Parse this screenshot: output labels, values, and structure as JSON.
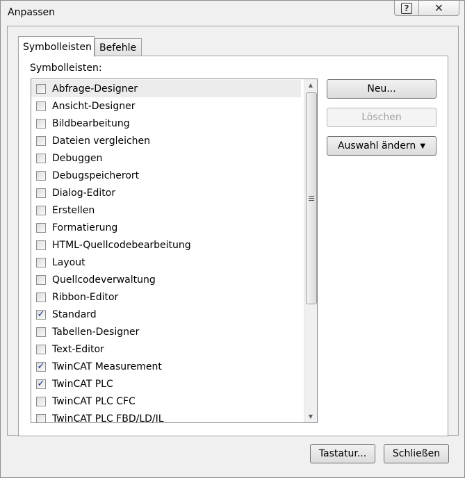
{
  "window": {
    "title": "Anpassen",
    "help_glyph": "?",
    "close_glyph": "✕"
  },
  "tabs": [
    {
      "label": "Symbolleisten",
      "active": true
    },
    {
      "label": "Befehle",
      "active": false
    }
  ],
  "toolbars_section": {
    "label": "Symbolleisten:",
    "items": [
      {
        "label": "Abfrage-Designer",
        "checked": false,
        "selected": true
      },
      {
        "label": "Ansicht-Designer",
        "checked": false
      },
      {
        "label": "Bildbearbeitung",
        "checked": false
      },
      {
        "label": "Dateien vergleichen",
        "checked": false
      },
      {
        "label": "Debuggen",
        "checked": false
      },
      {
        "label": "Debugspeicherort",
        "checked": false
      },
      {
        "label": "Dialog-Editor",
        "checked": false
      },
      {
        "label": "Erstellen",
        "checked": false
      },
      {
        "label": "Formatierung",
        "checked": false
      },
      {
        "label": "HTML-Quellcodebearbeitung",
        "checked": false
      },
      {
        "label": "Layout",
        "checked": false
      },
      {
        "label": "Quellcodeverwaltung",
        "checked": false
      },
      {
        "label": "Ribbon-Editor",
        "checked": false
      },
      {
        "label": "Standard",
        "checked": true
      },
      {
        "label": "Tabellen-Designer",
        "checked": false
      },
      {
        "label": "Text-Editor",
        "checked": false
      },
      {
        "label": "TwinCAT Measurement",
        "checked": true
      },
      {
        "label": "TwinCAT PLC",
        "checked": true
      },
      {
        "label": "TwinCAT PLC CFC",
        "checked": false
      },
      {
        "label": "TwinCAT PLC FBD/LD/IL",
        "checked": false
      }
    ],
    "check_glyph": "✓"
  },
  "side_buttons": {
    "new_label": "Neu...",
    "delete_label": "Löschen",
    "change_selection_label": "Auswahl ändern",
    "dropdown_glyph": "▼"
  },
  "footer": {
    "keyboard_label": "Tastatur...",
    "close_label": "Schließen"
  }
}
